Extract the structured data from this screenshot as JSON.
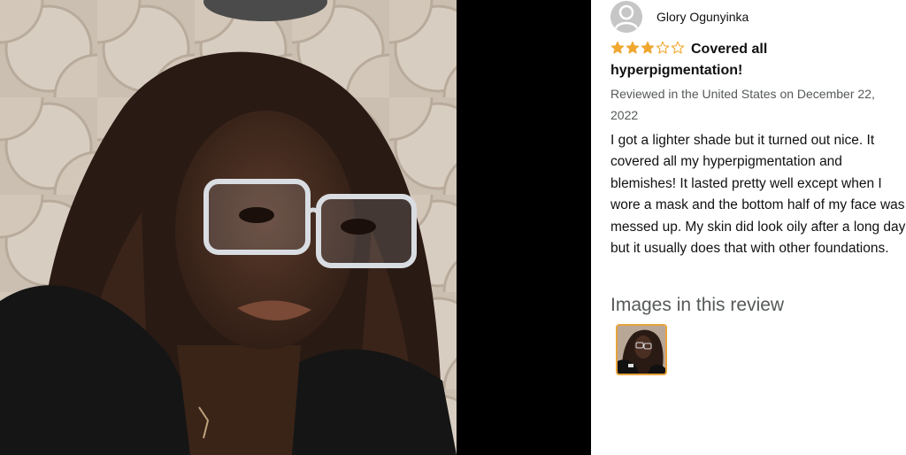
{
  "review": {
    "reviewer_name": "Glory Ogunyinka",
    "rating": 3,
    "rating_max": 5,
    "title": "Covered all hyperpigmentation!",
    "date": "Reviewed in the United States on December 22, 2022",
    "body": "I got a lighter shade but it turned out nice. It covered all my hyperpigmentation and blemishes! It lasted pretty well except when I wore a mask and the bottom half of my face was messed up. My skin did look oily after a long day but it usually does that with other foundations.",
    "images_heading": "Images in this review",
    "images": [
      {
        "icon": "review-photo-thumbnail"
      }
    ]
  },
  "icons": {
    "avatar": "user-avatar-icon",
    "star_filled": "star-filled-icon",
    "star_empty": "star-empty-icon"
  },
  "colors": {
    "star": "#f0a730",
    "thumbnail_border": "#e8a33c",
    "muted_text": "#565959",
    "panel_bg": "#ffffff",
    "viewer_bg": "#000000"
  }
}
